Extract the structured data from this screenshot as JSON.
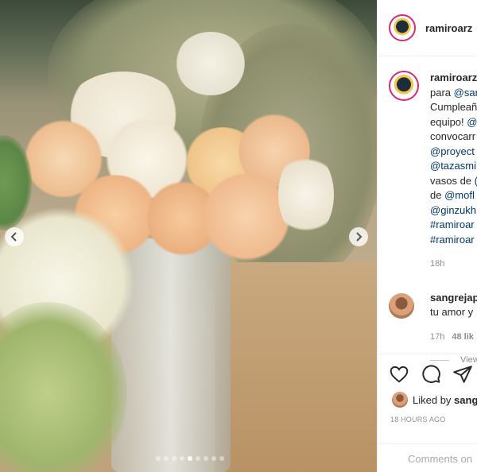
{
  "post": {
    "username": "ramiroarz",
    "caption_lines": [
      {
        "text": "para ",
        "link": "@san"
      },
      {
        "text": "Cumpleañ",
        "link": ""
      },
      {
        "text": "equipo! ",
        "link": "@"
      },
      {
        "text": "convocarr",
        "link": ""
      },
      {
        "text": "",
        "link": "@proyect"
      },
      {
        "text": "",
        "link": "@tazasmi"
      },
      {
        "text": "vasos de ",
        "link": "("
      },
      {
        "text": "de ",
        "link": "@mofl"
      },
      {
        "text": "",
        "link": "@ginzukh"
      },
      {
        "text": "",
        "link": "#ramiroar"
      },
      {
        "text": "",
        "link": "#ramiroar"
      }
    ],
    "caption_time": "18h",
    "liked_by_prefix": "Liked by",
    "liked_by_user": "sang",
    "timestamp": "18 HOURS AGO",
    "comment_placeholder": "Comments on"
  },
  "comment": {
    "username": "sangrejap",
    "text": "tu amor y",
    "time": "17h",
    "likes": "48 lik",
    "view_replies": "View"
  },
  "carousel": {
    "prev_icon": "chevron-left",
    "next_icon": "chevron-right",
    "slide_count": 9,
    "active_index": 4
  },
  "colors": {
    "link": "#00376b",
    "muted": "#8e8e8e",
    "story_ring": "#d62976"
  }
}
